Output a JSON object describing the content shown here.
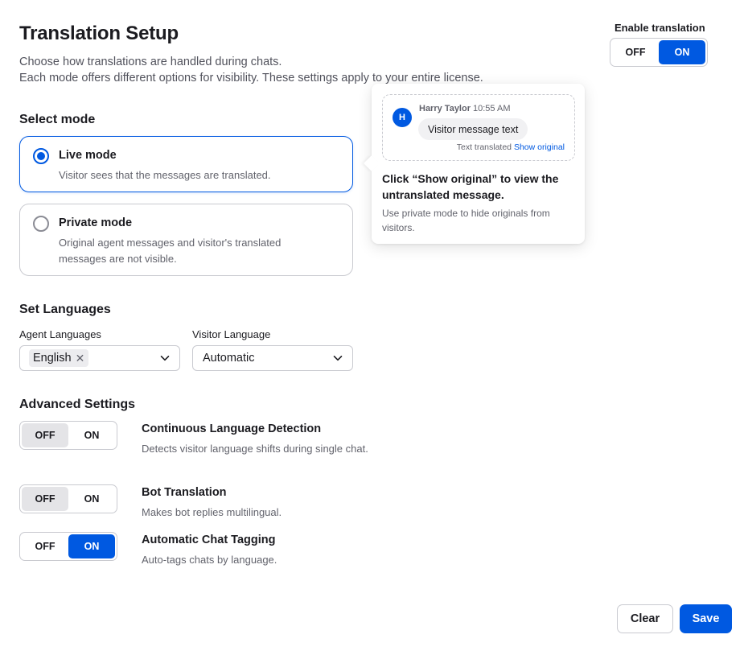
{
  "header": {
    "title": "Translation Setup",
    "subtitle_line1": "Choose how translations are handled during chats.",
    "subtitle_line2": "Each mode offers different options for visibility. These settings apply to your entire license."
  },
  "enable_translation": {
    "label": "Enable translation",
    "off_label": "OFF",
    "on_label": "ON",
    "value": "ON"
  },
  "modes": {
    "heading": "Select mode",
    "items": [
      {
        "title": "Live mode",
        "description": "Visitor sees that the messages are translated.",
        "selected": true
      },
      {
        "title": "Private mode",
        "description": "Original agent messages and visitor's translated messages are not visible.",
        "selected": false
      }
    ]
  },
  "languages": {
    "heading": "Set Languages",
    "agent_label": "Agent Languages",
    "agent_values": [
      "English"
    ],
    "visitor_label": "Visitor Language",
    "visitor_value": "Automatic"
  },
  "advanced": {
    "heading": "Advanced Settings",
    "items": [
      {
        "off_label": "OFF",
        "on_label": "ON",
        "value": "OFF",
        "title": "Continuous Language Detection",
        "description": "Detects visitor language shifts during single chat."
      },
      {
        "off_label": "OFF",
        "on_label": "ON",
        "value": "OFF",
        "title": "Bot Translation",
        "description": "Makes bot replies multilingual."
      },
      {
        "off_label": "OFF",
        "on_label": "ON",
        "value": "ON",
        "title": "Automatic Chat Tagging",
        "description": "Auto-tags chats by language."
      }
    ]
  },
  "popover": {
    "avatar_initial": "H",
    "name": "Harry Taylor",
    "time": "10:55 AM",
    "message": "Visitor message text",
    "footnote": "Text translated",
    "link": "Show original",
    "title": "Click “Show original” to view the untranslated message.",
    "description": "Use private mode to hide originals from visitors."
  },
  "footer": {
    "clear_label": "Clear",
    "save_label": "Save"
  },
  "colors": {
    "accent": "#0059e1",
    "border": "#c9cad0",
    "muted_text": "#62636c"
  }
}
